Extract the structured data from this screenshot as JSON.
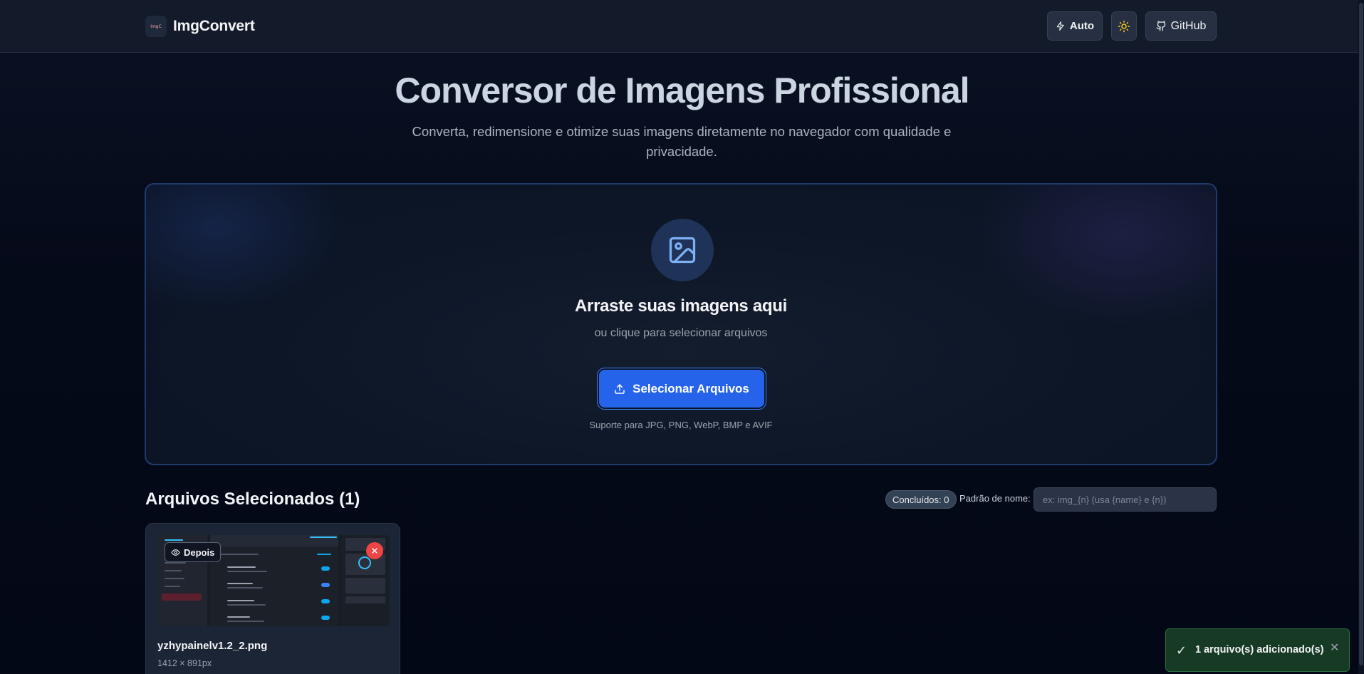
{
  "header": {
    "logo_text": "ImgC",
    "brand": "ImgConvert",
    "auto_label": "Auto",
    "github_label": "GitHub",
    "icons": {
      "auto": "lightning-icon",
      "theme": "sun-icon",
      "github": "github-icon"
    }
  },
  "hero": {
    "title": "Conversor de Imagens Profissional",
    "subtitle": "Converta, redimensione e otimize suas imagens diretamente no navegador com qualidade e privacidade."
  },
  "dropzone": {
    "title": "Arraste suas imagens aqui",
    "subtitle": "ou clique para selecionar arquivos",
    "button_label": "Selecionar Arquivos",
    "support_text": "Suporte para JPG, PNG, WebP, BMP e AVIF",
    "icon": "image-icon"
  },
  "files": {
    "title": "Arquivos Selecionados (1)",
    "done_badge": "Concluídos: 0",
    "pattern_label": "Padrão de nome:",
    "pattern_placeholder": "ex: img_{n} (usa {name} e {n})",
    "pattern_value": "",
    "items": [
      {
        "toggle_label": "Depois",
        "name": "yzhypainelv1.2_2.png",
        "dimensions": "1412 × 891px"
      }
    ]
  },
  "toast": {
    "message": "1 arquivo(s) adicionado(s)",
    "check": "✓",
    "close": "✕"
  },
  "colors": {
    "accent": "#2563eb",
    "danger": "#ef4444",
    "success_bg": "#173a25",
    "background": "#050a19"
  }
}
